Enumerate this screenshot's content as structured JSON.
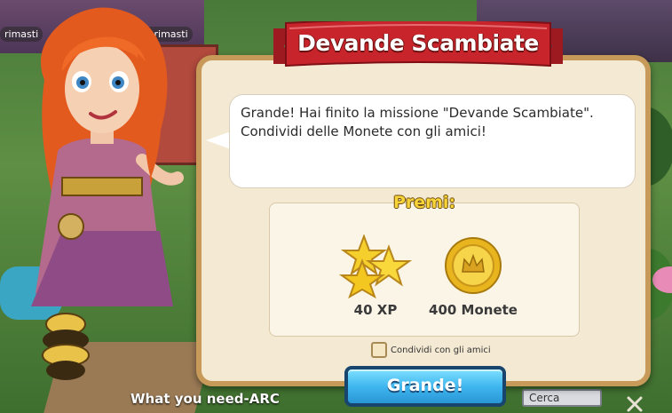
{
  "background": {
    "pill_left": "rimasti",
    "pill_right": "0 rimasti",
    "bottom_label": "What you need-ARC",
    "search_placeholder": "Cerca"
  },
  "dialog": {
    "title": "Devande Scambiate",
    "message_line1": "Grande! Hai finito la missione \"Devande Scambiate\".",
    "message_line2": "Condividi delle Monete con gli amici!",
    "rewards_title": "Premi:",
    "rewards": [
      {
        "icon": "xp-stars-icon",
        "label": "40 XP"
      },
      {
        "icon": "gold-coin-icon",
        "label": "400 Monete"
      }
    ],
    "share_checkbox_label": "Condividi con gli amici",
    "share_checked": false,
    "ok_button_label": "Grande!"
  },
  "colors": {
    "banner_red": "#c8242c",
    "dialog_bg": "#f4ead3",
    "dialog_border": "#c79a5a",
    "button_blue": "#3fb7ef",
    "rewards_title_yellow": "#f7d437"
  }
}
